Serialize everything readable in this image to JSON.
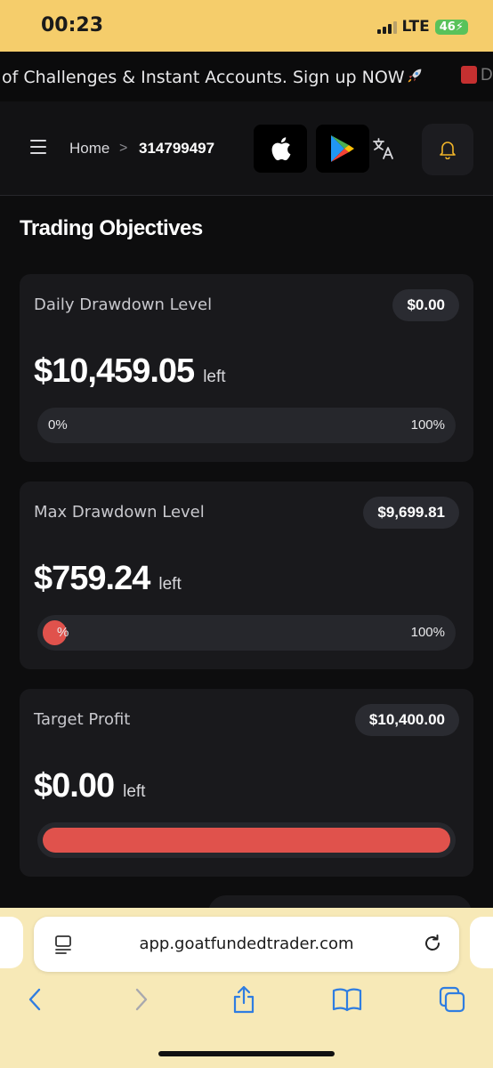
{
  "status": {
    "time": "00:23",
    "network": "LTE",
    "battery": "46"
  },
  "ticker": {
    "text": "of Challenges & Instant Accounts. Sign up NOW",
    "more": "D"
  },
  "header": {
    "home": "Home",
    "separator": ">",
    "account_id": "314799497"
  },
  "page_title": "Trading Objectives",
  "cards": [
    {
      "label": "Daily Drawdown Level",
      "pill": "$0.00",
      "amount": "$10,459.05",
      "suffix": "left",
      "bar_min": "0%",
      "bar_max": "100%",
      "fill_fraction": 0.0
    },
    {
      "label": "Max Drawdown Level",
      "pill": "$9,699.81",
      "amount": "$759.24",
      "suffix": "left",
      "bar_min": "%",
      "bar_max": "100%",
      "fill_fraction": 0.06
    },
    {
      "label": "Target Profit",
      "pill": "$10,400.00",
      "amount": "$0.00",
      "suffix": "left",
      "fill_fraction": 1.0
    }
  ],
  "colors": {
    "accent_red": "#e0524c",
    "status_bar": "#f5cd6b",
    "bell": "#f0b429"
  },
  "browser": {
    "url": "app.goatfundedtrader.com"
  }
}
